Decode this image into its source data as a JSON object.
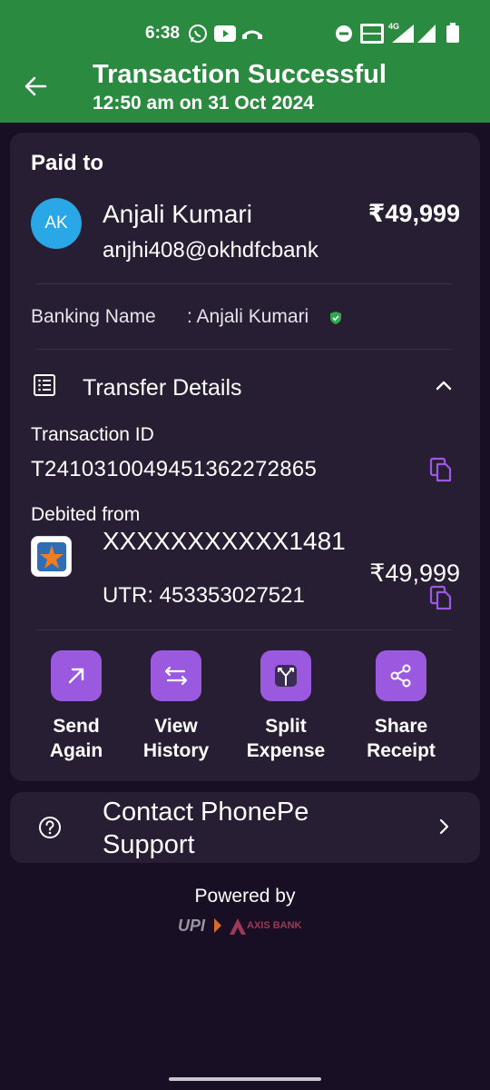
{
  "status_bar": {
    "time": "6:38",
    "network_label": "4G"
  },
  "header": {
    "title": "Transaction Successful",
    "subtitle": "12:50 am on 31 Oct 2024",
    "accent_color": "#2a8a3f"
  },
  "payment": {
    "section_label": "Paid to",
    "avatar_initials": "AK",
    "payee_name": "Anjali Kumari",
    "payee_vpa": "anjhi408@okhdfcbank",
    "amount": "₹49,999",
    "banking_name_label": "Banking Name",
    "banking_name_value": ": Anjali Kumari"
  },
  "transfer_details": {
    "title": "Transfer Details",
    "transaction_id_label": "Transaction ID",
    "transaction_id": "T2410310049451362272865",
    "debited_from_label": "Debited from",
    "account_number": "XXXXXXXXXXX1481",
    "utr": "UTR: 453353027521",
    "debit_amount": "₹49,999"
  },
  "actions": [
    {
      "label": "Send\nAgain",
      "icon": "arrow-up-right-icon"
    },
    {
      "label": "View\nHistory",
      "icon": "swap-arrows-icon"
    },
    {
      "label": "Split\nExpense",
      "icon": "split-icon"
    },
    {
      "label": "Share\nReceipt",
      "icon": "share-icon"
    }
  ],
  "support": {
    "label": "Contact PhonePe Support"
  },
  "footer": {
    "powered_by": "Powered by",
    "upi_logo_text": "UPI",
    "bank_logo_text": "AXIS BANK"
  },
  "colors": {
    "action_purple": "#9b59e0",
    "card_bg": "#271e33",
    "page_bg": "#180f24"
  }
}
